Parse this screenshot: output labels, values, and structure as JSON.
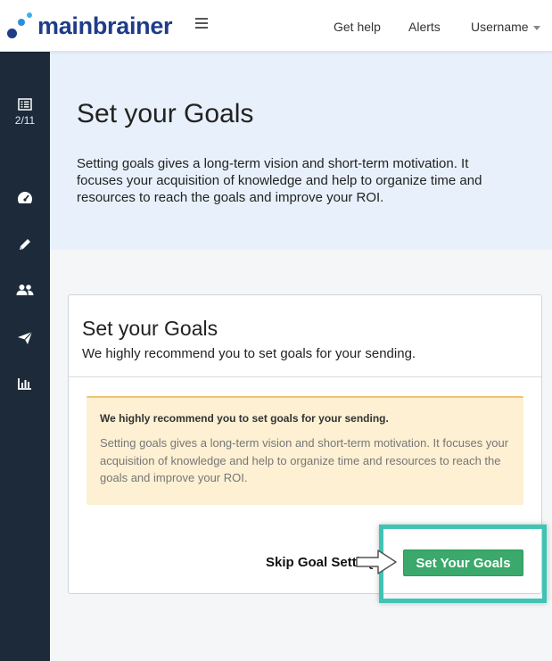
{
  "header": {
    "logo_main": "main",
    "logo_brainer": "brainer",
    "nav": {
      "get_help": "Get help",
      "alerts": "Alerts",
      "username": "Username"
    }
  },
  "sidebar": {
    "items": [
      {
        "icon": "list-icon",
        "count": "2/11"
      },
      {
        "icon": "dashboard-gauge-icon"
      },
      {
        "icon": "pencil-icon"
      },
      {
        "icon": "users-icon"
      },
      {
        "icon": "paper-plane-icon"
      },
      {
        "icon": "bar-chart-icon"
      }
    ]
  },
  "hero": {
    "title": "Set your Goals",
    "description": "Setting goals gives a long-term vision and short-term motivation. It focuses your acquisition of knowledge and help to organize time and resources to reach the goals and improve your ROI."
  },
  "card": {
    "title": "Set your Goals",
    "subtitle": "We highly recommend you to set goals for your sending.",
    "alert_heading": "We highly recommend you to set goals for your sending.",
    "alert_body": "Setting goals gives a long-term vision and short-term motivation. It focuses your acquisition of knowledge and help to organize time and resources to reach the goals and improve your ROI.",
    "skip_label": "Skip Goal Setting",
    "set_label": "Set Your Goals"
  },
  "colors": {
    "sidebar": "#1c2a3a",
    "hero": "#e8f1fb",
    "primary_button": "#3aa96b",
    "highlight": "#3fc4b4",
    "alert_bg": "#fdf0d3",
    "logo": "#1f3c88"
  }
}
